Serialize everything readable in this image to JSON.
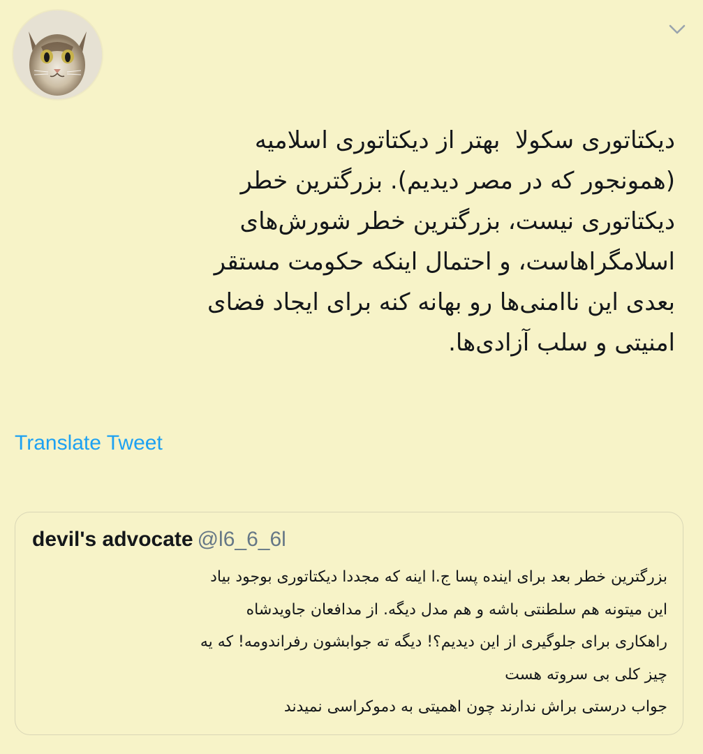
{
  "header": {
    "avatar_icon": "cat-avatar",
    "menu_icon": "chevron-down-icon"
  },
  "tweet": {
    "text": "دیکتاتوری سکولا  بهتر از دیکتاتوری اسلامیه\n(همونجور که در مصر دیدیم). بزرگترین خطر\nدیکتاتوری نیست، بزرگترین خطر شورش‌های\nاسلامگراهاست، و احتمال اینکه حکومت مستقر\nبعدی این ناامنی‌ها رو بهانه کنه برای ایجاد فضای\nامنیتی و سلب آزادی‌ها.",
    "translate_label": "Translate Tweet"
  },
  "quoted_tweet": {
    "name": "devil's advocate",
    "handle": "@l6_6_6l",
    "text": "بزرگترین خطر بعد برای اینده پسا ج.ا اینه که مجددا دیکتاتوری بوجود بیاد\nاین میتونه هم سلطنتی باشه و هم مدل دیگه. از مدافعان جاویدشاه\nراهکاری برای جلوگیری از این دیدیم؟! دیگه ته جوابشون رفراندومه! که یه\nچیز کلی بی سروته هست\nجواب درستی براش ندارند چون اهمیتی به دموکراسی نمیدند"
  },
  "colors": {
    "background": "#f7f3c8",
    "link": "#1da1f2",
    "text": "#14171a",
    "muted": "#657786"
  }
}
